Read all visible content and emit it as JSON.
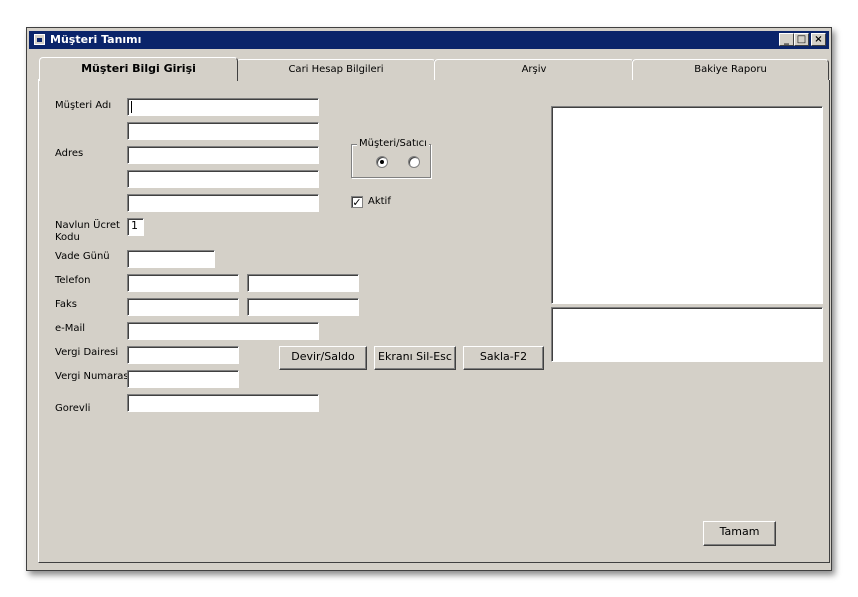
{
  "window": {
    "title": "Müşteri Tanımı",
    "controls": [
      "_",
      "□",
      "×"
    ]
  },
  "tabs": [
    {
      "label": "Müşteri Bilgi Girişi",
      "active": true
    },
    {
      "label": "Cari Hesap Bilgileri",
      "active": false
    },
    {
      "label": "Arşiv",
      "active": false
    },
    {
      "label": "Bakiye Raporu",
      "active": false
    }
  ],
  "form": {
    "musteri_adi_label": "Müşteri Adı",
    "adres_label": "Adres",
    "navlun_label_1": "Navlun Ücret",
    "navlun_label_2": "Kodu",
    "navlun_value": "1",
    "vade_label": "Vade Günü",
    "telefon_label": "Telefon",
    "faks_label": "Faks",
    "email_label": "e-Mail",
    "vergi_dairesi_label": "Vergi Dairesi",
    "vergi_numarasi_label": "Vergi Numarası",
    "gorevli_label": "Gorevli"
  },
  "group": {
    "title": "Müşteri/Satıcı",
    "selected": 0
  },
  "aktif": {
    "label": "Aktif",
    "checked": true
  },
  "buttons": {
    "devir": "Devir/Saldo",
    "ekrani_sil": "Ekranı Sil-Esc",
    "sakla": "Sakla-F2",
    "tamam": "Tamam"
  }
}
